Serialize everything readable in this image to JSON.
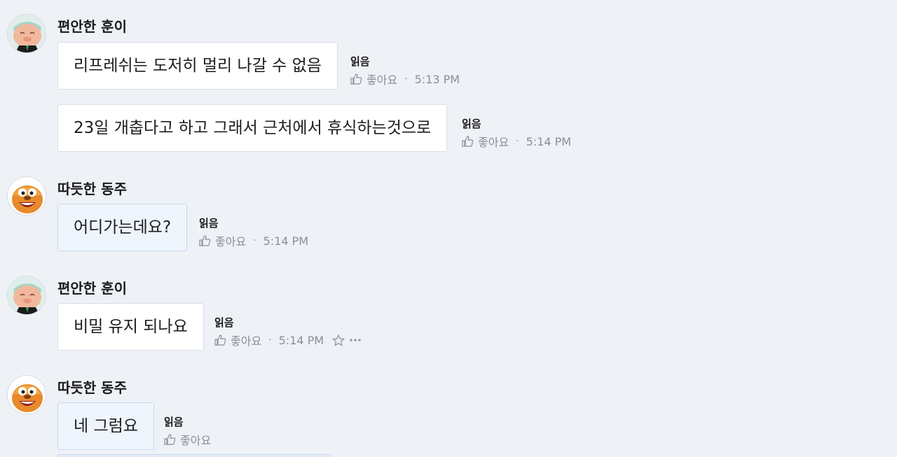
{
  "read_label": "읽음",
  "like_label": "좋아요",
  "messages": [
    {
      "sender": "편안한 훈이",
      "bubbles": [
        {
          "text": "리프레쉬는 도저히 멀리 나갈 수 없음",
          "time": "5:13 PM"
        },
        {
          "text": "23일 개춥다고 하고 그래서 근처에서 휴식하는것으로",
          "time": "5:14 PM"
        }
      ]
    },
    {
      "sender": "따듯한 동주",
      "bubbles": [
        {
          "text": "어디가는데요?",
          "time": "5:14 PM"
        }
      ]
    },
    {
      "sender": "편안한 훈이",
      "bubbles": [
        {
          "text": "비밀 유지 되나요",
          "time": "5:14 PM"
        }
      ]
    },
    {
      "sender": "따듯한 동주",
      "bubbles": [
        {
          "text": "네 그럼요",
          "time": ""
        }
      ]
    }
  ],
  "icons": {
    "like": "thumbs-up-icon",
    "star": "star-icon",
    "more": "more-icon"
  },
  "colors": {
    "background": "#eef1f6",
    "own_bubble": "#ffffff",
    "their_bubble": "#eef5fd",
    "meta_text": "#8a8f98"
  }
}
